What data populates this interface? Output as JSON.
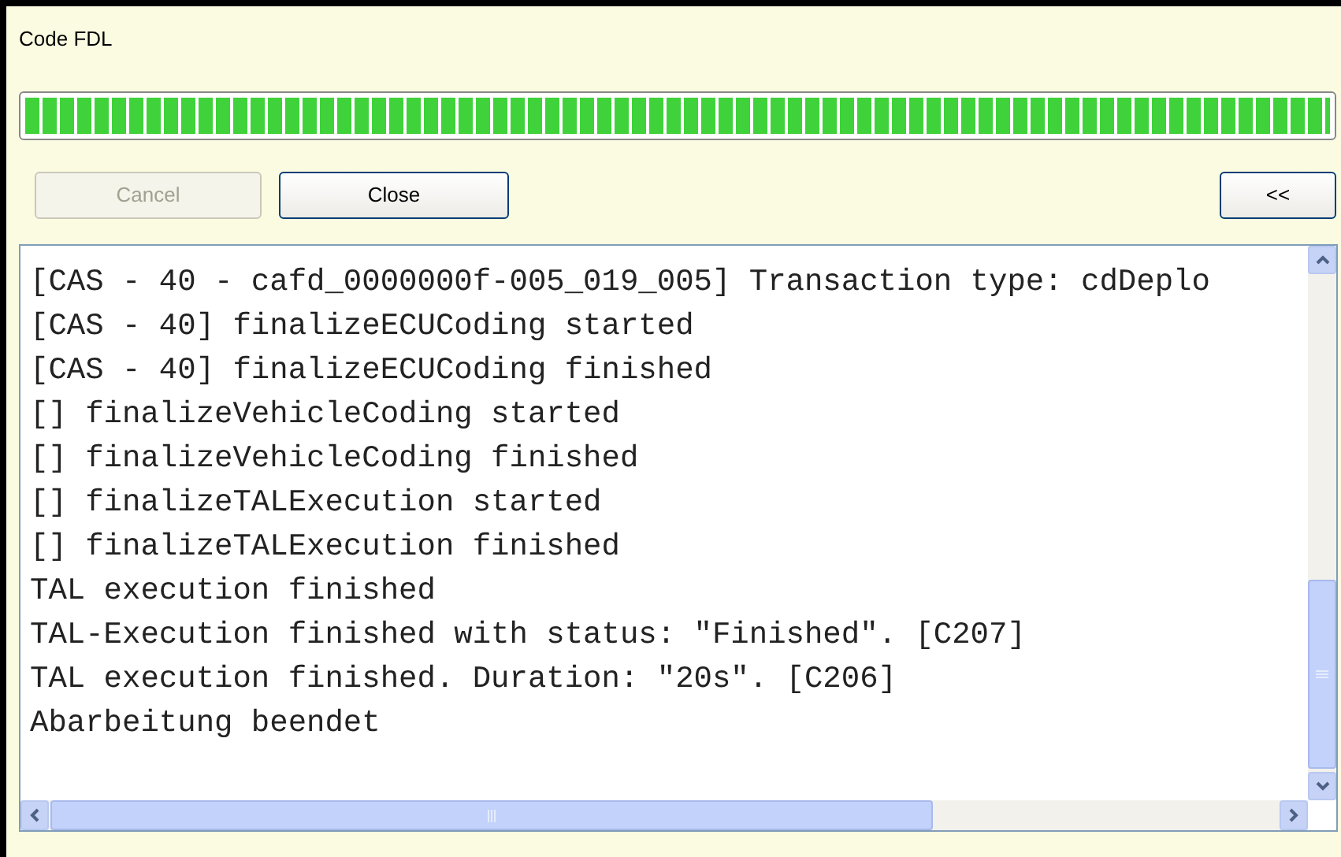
{
  "window": {
    "title": "Code FDL"
  },
  "progress": {
    "level": 1
  },
  "buttons": [
    {
      "label": "Cancel",
      "disabled": true
    },
    {
      "label": "Close",
      "disabled": false
    }
  ],
  "toggle_button": {
    "label": "<<"
  },
  "log": {
    "lines": [
      "[CAS - 40 - cafd_0000000f-005_019_005] Transaction type: cdDeplo",
      "[CAS - 40] finalizeECUCoding started",
      "[CAS - 40] finalizeECUCoding finished",
      "[] finalizeVehicleCoding started",
      "[] finalizeVehicleCoding finished",
      "[] finalizeTALExecution started",
      "[] finalizeTALExecution finished",
      "TAL execution finished",
      "TAL-Execution finished with status: \"Finished\". [C207]",
      "TAL execution finished. Duration: \"20s\". [C206]",
      "Abarbeitung beendet"
    ]
  }
}
